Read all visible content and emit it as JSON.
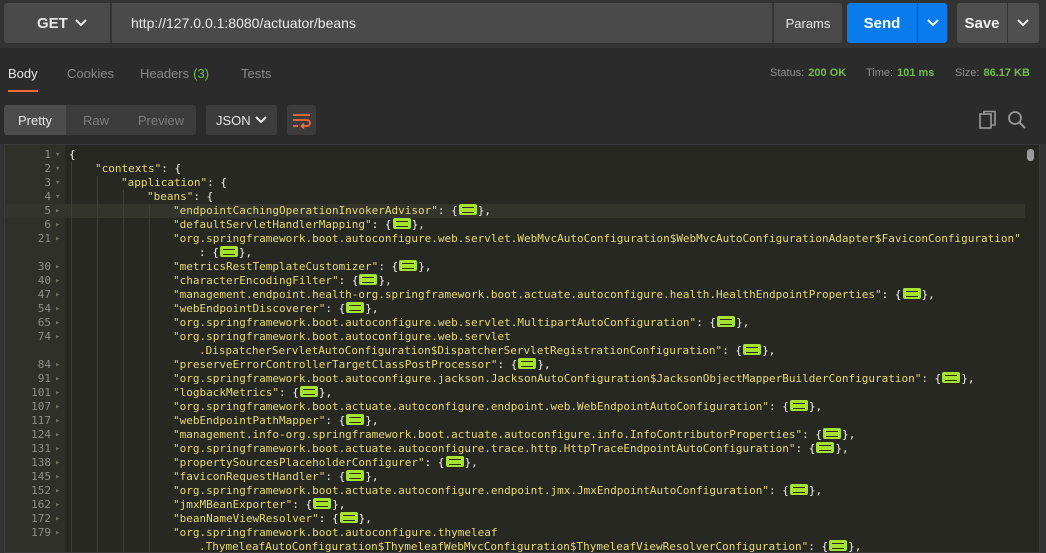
{
  "request": {
    "method": "GET",
    "url": "http://127.0.0.1:8080/actuator/beans",
    "params_label": "Params",
    "send_label": "Send",
    "save_label": "Save"
  },
  "response_tabs": [
    {
      "label": "Body",
      "active": true
    },
    {
      "label": "Cookies",
      "active": false
    },
    {
      "label": "Headers",
      "count": "(3)",
      "active": false
    },
    {
      "label": "Tests",
      "active": false
    }
  ],
  "status": {
    "status_label": "Status:",
    "status_value": "200 OK",
    "time_label": "Time:",
    "time_value": "101 ms",
    "size_label": "Size:",
    "size_value": "86.17 KB"
  },
  "view_modes": [
    "Pretty",
    "Raw",
    "Preview"
  ],
  "format": "JSON",
  "colors": {
    "accent": "#f26b3a",
    "send": "#097bed",
    "success": "#6fbf4b",
    "string": "#e6db74",
    "collapsed": "#a6e22e"
  },
  "icons": [
    "chevron-down-icon",
    "wrap-lines-icon",
    "copy-icon",
    "search-icon",
    "fold-arrow-icon"
  ],
  "code_lines": [
    {
      "n": "1",
      "indent": 0,
      "parts": [
        [
          "p",
          "{"
        ]
      ],
      "fold": true
    },
    {
      "n": "2",
      "indent": 1,
      "parts": [
        [
          "k",
          "\"contexts\""
        ],
        [
          "p",
          ": {"
        ]
      ],
      "fold": true
    },
    {
      "n": "3",
      "indent": 2,
      "parts": [
        [
          "k",
          "\"application\""
        ],
        [
          "p",
          ": {"
        ]
      ],
      "fold": true
    },
    {
      "n": "4",
      "indent": 3,
      "parts": [
        [
          "k",
          "\"beans\""
        ],
        [
          "p",
          ": {"
        ]
      ],
      "fold": true
    },
    {
      "n": "5",
      "indent": 4,
      "parts": [
        [
          "k",
          "\"endpointCachingOperationInvokerAdvisor\""
        ],
        [
          "p",
          ": {"
        ],
        [
          "e",
          ""
        ],
        [
          "p",
          "},"
        ]
      ],
      "fold": true,
      "hl": true
    },
    {
      "n": "6",
      "indent": 4,
      "parts": [
        [
          "k",
          "\"defaultServletHandlerMapping\""
        ],
        [
          "p",
          ": {"
        ],
        [
          "e",
          ""
        ],
        [
          "p",
          "},"
        ]
      ],
      "fold": true
    },
    {
      "n": "21",
      "indent": 4,
      "parts": [
        [
          "k",
          "\"org.springframework.boot.autoconfigure.web.servlet.WebMvcAutoConfiguration$WebMvcAutoConfigurationAdapter$FaviconConfiguration\""
        ]
      ],
      "fold": true
    },
    {
      "n": "",
      "indent": 5,
      "parts": [
        [
          "p",
          ": {"
        ],
        [
          "e",
          ""
        ],
        [
          "p",
          "},"
        ]
      ]
    },
    {
      "n": "30",
      "indent": 4,
      "parts": [
        [
          "k",
          "\"metricsRestTemplateCustomizer\""
        ],
        [
          "p",
          ": {"
        ],
        [
          "e",
          ""
        ],
        [
          "p",
          "},"
        ]
      ],
      "fold": true
    },
    {
      "n": "40",
      "indent": 4,
      "parts": [
        [
          "k",
          "\"characterEncodingFilter\""
        ],
        [
          "p",
          ": {"
        ],
        [
          "e",
          ""
        ],
        [
          "p",
          "},"
        ]
      ],
      "fold": true
    },
    {
      "n": "47",
      "indent": 4,
      "parts": [
        [
          "k",
          "\"management.endpoint.health-org.springframework.boot.actuate.autoconfigure.health.HealthEndpointProperties\""
        ],
        [
          "p",
          ": {"
        ],
        [
          "e",
          ""
        ],
        [
          "p",
          "},"
        ]
      ],
      "fold": true
    },
    {
      "n": "54",
      "indent": 4,
      "parts": [
        [
          "k",
          "\"webEndpointDiscoverer\""
        ],
        [
          "p",
          ": {"
        ],
        [
          "e",
          ""
        ],
        [
          "p",
          "},"
        ]
      ],
      "fold": true
    },
    {
      "n": "65",
      "indent": 4,
      "parts": [
        [
          "k",
          "\"org.springframework.boot.autoconfigure.web.servlet.MultipartAutoConfiguration\""
        ],
        [
          "p",
          ": {"
        ],
        [
          "e",
          ""
        ],
        [
          "p",
          "},"
        ]
      ],
      "fold": true
    },
    {
      "n": "74",
      "indent": 4,
      "parts": [
        [
          "k",
          "\"org.springframework.boot.autoconfigure.web.servlet"
        ]
      ],
      "fold": true
    },
    {
      "n": "",
      "indent": 5,
      "parts": [
        [
          "k",
          ".DispatcherServletAutoConfiguration$DispatcherServletRegistrationConfiguration\""
        ],
        [
          "p",
          ": {"
        ],
        [
          "e",
          ""
        ],
        [
          "p",
          "},"
        ]
      ]
    },
    {
      "n": "84",
      "indent": 4,
      "parts": [
        [
          "k",
          "\"preserveErrorControllerTargetClassPostProcessor\""
        ],
        [
          "p",
          ": {"
        ],
        [
          "e",
          ""
        ],
        [
          "p",
          "},"
        ]
      ],
      "fold": true
    },
    {
      "n": "91",
      "indent": 4,
      "parts": [
        [
          "k",
          "\"org.springframework.boot.autoconfigure.jackson.JacksonAutoConfiguration$JacksonObjectMapperBuilderConfiguration\""
        ],
        [
          "p",
          ": {"
        ],
        [
          "e",
          ""
        ],
        [
          "p",
          "},"
        ]
      ],
      "fold": true
    },
    {
      "n": "101",
      "indent": 4,
      "parts": [
        [
          "k",
          "\"logbackMetrics\""
        ],
        [
          "p",
          ": {"
        ],
        [
          "e",
          ""
        ],
        [
          "p",
          "},"
        ]
      ],
      "fold": true
    },
    {
      "n": "107",
      "indent": 4,
      "parts": [
        [
          "k",
          "\"org.springframework.boot.actuate.autoconfigure.endpoint.web.WebEndpointAutoConfiguration\""
        ],
        [
          "p",
          ": {"
        ],
        [
          "e",
          ""
        ],
        [
          "p",
          "},"
        ]
      ],
      "fold": true
    },
    {
      "n": "117",
      "indent": 4,
      "parts": [
        [
          "k",
          "\"webEndpointPathMapper\""
        ],
        [
          "p",
          ": {"
        ],
        [
          "e",
          ""
        ],
        [
          "p",
          "},"
        ]
      ],
      "fold": true
    },
    {
      "n": "124",
      "indent": 4,
      "parts": [
        [
          "k",
          "\"management.info-org.springframework.boot.actuate.autoconfigure.info.InfoContributorProperties\""
        ],
        [
          "p",
          ": {"
        ],
        [
          "e",
          ""
        ],
        [
          "p",
          "},"
        ]
      ],
      "fold": true
    },
    {
      "n": "131",
      "indent": 4,
      "parts": [
        [
          "k",
          "\"org.springframework.boot.actuate.autoconfigure.trace.http.HttpTraceEndpointAutoConfiguration\""
        ],
        [
          "p",
          ": {"
        ],
        [
          "e",
          ""
        ],
        [
          "p",
          "},"
        ]
      ],
      "fold": true
    },
    {
      "n": "138",
      "indent": 4,
      "parts": [
        [
          "k",
          "\"propertySourcesPlaceholderConfigurer\""
        ],
        [
          "p",
          ": {"
        ],
        [
          "e",
          ""
        ],
        [
          "p",
          "},"
        ]
      ],
      "fold": true
    },
    {
      "n": "145",
      "indent": 4,
      "parts": [
        [
          "k",
          "\"faviconRequestHandler\""
        ],
        [
          "p",
          ": {"
        ],
        [
          "e",
          ""
        ],
        [
          "p",
          "},"
        ]
      ],
      "fold": true
    },
    {
      "n": "152",
      "indent": 4,
      "parts": [
        [
          "k",
          "\"org.springframework.boot.actuate.autoconfigure.endpoint.jmx.JmxEndpointAutoConfiguration\""
        ],
        [
          "p",
          ": {"
        ],
        [
          "e",
          ""
        ],
        [
          "p",
          "},"
        ]
      ],
      "fold": true
    },
    {
      "n": "162",
      "indent": 4,
      "parts": [
        [
          "k",
          "\"jmxMBeanExporter\""
        ],
        [
          "p",
          ": {"
        ],
        [
          "e",
          ""
        ],
        [
          "p",
          "},"
        ]
      ],
      "fold": true
    },
    {
      "n": "172",
      "indent": 4,
      "parts": [
        [
          "k",
          "\"beanNameViewResolver\""
        ],
        [
          "p",
          ": {"
        ],
        [
          "e",
          ""
        ],
        [
          "p",
          "},"
        ]
      ],
      "fold": true
    },
    {
      "n": "179",
      "indent": 4,
      "parts": [
        [
          "k",
          "\"org.springframework.boot.autoconfigure.thymeleaf"
        ]
      ],
      "fold": true
    },
    {
      "n": "",
      "indent": 5,
      "parts": [
        [
          "k",
          ".ThymeleafAutoConfiguration$ThymeleafWebMvcConfiguration$ThymeleafViewResolverConfiguration\""
        ],
        [
          "p",
          ": {"
        ],
        [
          "e",
          ""
        ],
        [
          "p",
          "},"
        ]
      ]
    }
  ]
}
